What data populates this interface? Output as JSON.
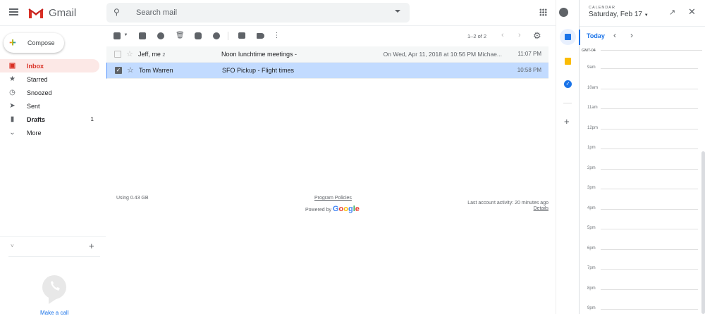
{
  "header": {
    "brand": "Gmail",
    "search_placeholder": "Search mail"
  },
  "sidebar": {
    "compose": "Compose",
    "items": [
      {
        "label": "Inbox",
        "count": ""
      },
      {
        "label": "Starred",
        "count": ""
      },
      {
        "label": "Snoozed",
        "count": ""
      },
      {
        "label": "Sent",
        "count": ""
      },
      {
        "label": "Drafts",
        "count": "1"
      },
      {
        "label": "More",
        "count": ""
      }
    ],
    "hangouts_add": "+",
    "call_label": "Make a call"
  },
  "toolbar": {
    "pagination": "1–2 of 2"
  },
  "emails": [
    {
      "from": "Jeff, me",
      "count": "2",
      "subject": "Noon lunchtime meetings -",
      "snippet": "On Wed, Apr 11, 2018 at 10:56 PM Michae...",
      "time": "11:07 PM",
      "selected": false
    },
    {
      "from": "Tom Warren",
      "count": "",
      "subject": "SFO Pickup  - Flight times",
      "snippet": "",
      "time": "10:58 PM",
      "selected": true
    }
  ],
  "footer": {
    "storage": "Using 0.43 GB",
    "policies": "Program Policies",
    "powered": "Powered by",
    "google": "Google",
    "activity": "Last account activity: 20 minutes ago",
    "details": "Details"
  },
  "calendar": {
    "label": "CALENDAR",
    "date": "Saturday, Feb 17",
    "today": "Today",
    "timezone": "GMT-04",
    "hours": [
      "9am",
      "10am",
      "11am",
      "12pm",
      "1pm",
      "2pm",
      "3pm",
      "4pm",
      "5pm",
      "6pm",
      "7pm",
      "8pm",
      "9pm"
    ]
  },
  "colors": {
    "accent": "#1a73e8",
    "inbox_red": "#d93025",
    "selected_row": "#c2dbff"
  }
}
